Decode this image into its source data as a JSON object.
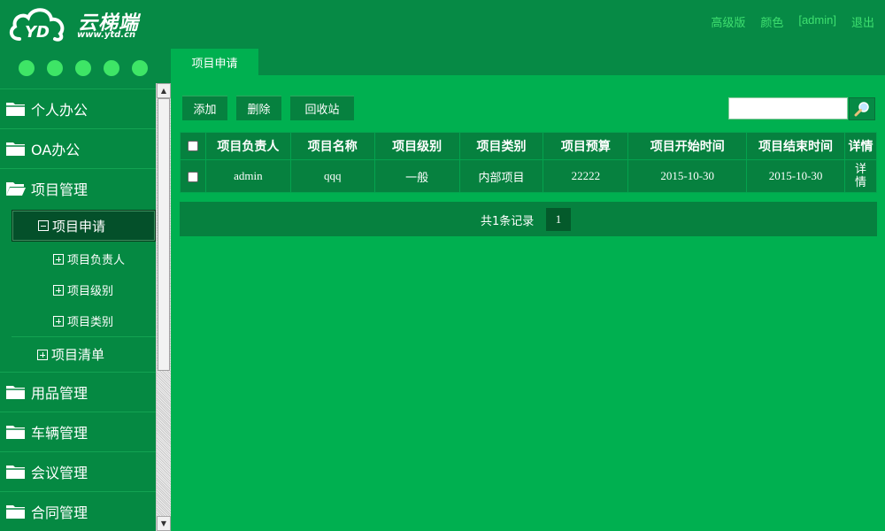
{
  "header": {
    "logo_text": "云梯端",
    "logo_url": "www.ytd.cn",
    "links": [
      "高级版",
      "颜色",
      "[admin]",
      "退出"
    ]
  },
  "sidebar": {
    "menus": [
      {
        "label": "个人办公"
      },
      {
        "label": "OA办公"
      },
      {
        "label": "项目管理"
      },
      {
        "label": "用品管理"
      },
      {
        "label": "车辆管理"
      },
      {
        "label": "会议管理"
      },
      {
        "label": "合同管理"
      }
    ],
    "submenus": [
      {
        "label": "项目申请",
        "expanded": true
      },
      {
        "label": "项目清单",
        "expanded": false
      }
    ],
    "subsubmenus": [
      {
        "label": "项目负责人"
      },
      {
        "label": "项目级别"
      },
      {
        "label": "项目类别"
      }
    ]
  },
  "tab": {
    "label": "项目申请"
  },
  "toolbar": {
    "add_label": "添加",
    "delete_label": "删除",
    "recycle_label": "回收站",
    "search_value": ""
  },
  "table": {
    "headers": [
      "项目负责人",
      "项目名称",
      "项目级别",
      "项目类别",
      "项目预算",
      "项目开始时间",
      "项目结束时间",
      "详情"
    ],
    "rows": [
      {
        "owner": "admin",
        "name": "qqq",
        "level": "一般",
        "category": "内部项目",
        "budget": "22222",
        "start": "2015-10-30",
        "end": "2015-10-30",
        "detail": "详情"
      }
    ]
  },
  "pager": {
    "summary": "共1条记录",
    "current_page": "1"
  },
  "colors": {
    "header_bg": "#068a45",
    "content_bg": "#00b050",
    "accent": "#3ee566"
  },
  "icons": [
    "cloud-logo-icon",
    "folder-icon",
    "collapse-box-icon",
    "expand-box-icon",
    "search-icon"
  ]
}
